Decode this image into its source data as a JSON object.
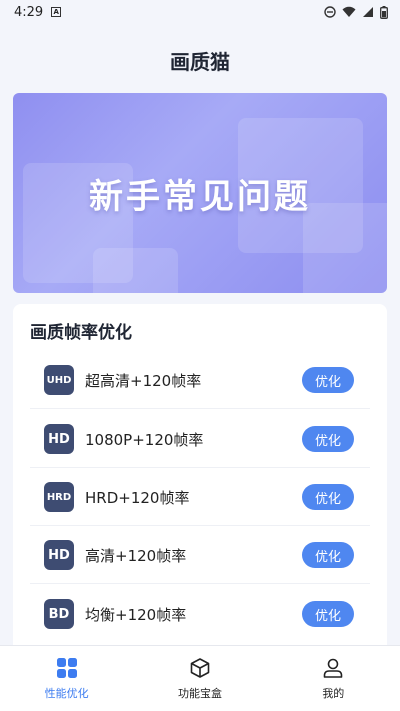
{
  "status": {
    "time": "4:29",
    "notif_icon": "A",
    "icons": [
      "dnd-icon",
      "wifi-icon",
      "signal-icon",
      "battery-icon"
    ]
  },
  "app": {
    "title": "画质猫"
  },
  "banner": {
    "text": "新手常见问题"
  },
  "section": {
    "title": "画质帧率优化",
    "items": [
      {
        "badge": "UHD",
        "label": "超高清+120帧率",
        "button": "优化"
      },
      {
        "badge": "HD",
        "label": "1080P+120帧率",
        "button": "优化"
      },
      {
        "badge": "HRD",
        "label": "HRD+120帧率",
        "button": "优化"
      },
      {
        "badge": "HD",
        "label": "高清+120帧率",
        "button": "优化"
      },
      {
        "badge": "BD",
        "label": "均衡+120帧率",
        "button": "优化"
      }
    ]
  },
  "tabs": [
    {
      "label": "性能优化",
      "icon": "grid-icon",
      "active": true
    },
    {
      "label": "功能宝盒",
      "icon": "box-icon",
      "active": false
    },
    {
      "label": "我的",
      "icon": "user-icon",
      "active": false
    }
  ],
  "colors": {
    "accent": "#4f87f0",
    "active_tab": "#3d7cf0",
    "badge": "#3e4c72"
  }
}
